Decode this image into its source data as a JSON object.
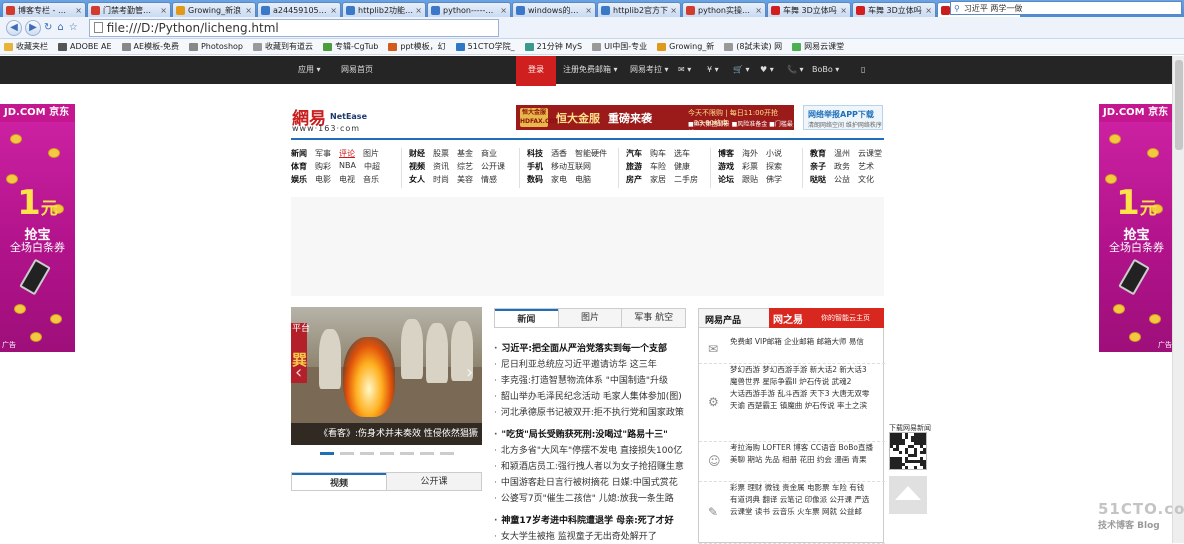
{
  "browser": {
    "tabs": [
      {
        "label": "博客专栏 - 博客",
        "color": "#d23c2e"
      },
      {
        "label": "门禁考勤管理系",
        "color": "#d23c2e"
      },
      {
        "label": "Growing_新浪",
        "color": "#e09a1a"
      },
      {
        "label": "a244591052的",
        "color": "#3c78c8"
      },
      {
        "label": "httplib2功能_百",
        "color": "#3c78c8"
      },
      {
        "label": "python-----httpl",
        "color": "#3c78c8"
      },
      {
        "label": "windows的pyth",
        "color": "#3c78c8"
      },
      {
        "label": "httplib2官方下",
        "color": "#3c78c8"
      },
      {
        "label": "python实操http",
        "color": "#d23c2e"
      },
      {
        "label": "车舞 3D立体吗",
        "color": "#d21e1e"
      },
      {
        "label": "车舞 3D立体吗",
        "color": "#d21e1e"
      },
      {
        "label": "网易",
        "color": "#c81e1e",
        "active": true
      }
    ],
    "new_tab": "+",
    "search_value": "习近平 两学一做",
    "url": "file:///D:/Python/licheng.html",
    "bookmarks": [
      {
        "label": "收藏夹栏",
        "color": "#e9b338"
      },
      {
        "label": "ADOBE AE",
        "color": "#555"
      },
      {
        "label": "AE模板-免费",
        "color": "#888"
      },
      {
        "label": "Photoshop",
        "color": "#888"
      },
      {
        "label": "收藏到有道云",
        "color": "#999"
      },
      {
        "label": "专辑-CgTub",
        "color": "#4a9c3c"
      },
      {
        "label": "ppt模板，幻",
        "color": "#d35a1a"
      },
      {
        "label": "51CTO学院_",
        "color": "#2d79c7"
      },
      {
        "label": "21分钟 MyS",
        "color": "#3a9b8c"
      },
      {
        "label": "UI中国-专业",
        "color": "#999"
      },
      {
        "label": "Growing_新",
        "color": "#e09a1a"
      },
      {
        "label": "(8試未读) 网",
        "color": "#999"
      },
      {
        "label": "网易云课堂",
        "color": "#4caf50"
      }
    ]
  },
  "topnav": {
    "items": [
      "应用 ▾",
      "网易首页",
      "注册免费邮箱 ▾",
      "网易考拉 ▾",
      "✉ ▾",
      "¥ ▾",
      "🛒 ▾",
      "♥ ▾",
      "📞 ▾",
      "BoBo ▾",
      "▯"
    ],
    "login": "登录"
  },
  "side_ad": {
    "brand": "JD.COM 京东",
    "amount": "1",
    "unit": "元",
    "line1": "抢宝",
    "line2": "全场白条券",
    "ad_tag": "广告"
  },
  "header": {
    "logo_cn": "網易",
    "logo_en": "NetEase",
    "logo_url": "www·163·com",
    "banner": {
      "badge": "恒大金服 HDFAX.COM",
      "brand": "恒大金服",
      "slogan": "重磅来袭",
      "line1": "今天不限购 | 每日11:00开抢~23:00结束",
      "line2": "■恒大集团背景 ■风险准备金 ■门槛最低1000元"
    },
    "app_ad": {
      "title": "网络举报APP下载",
      "sub": "清朗网络空间 维护网络秩序"
    }
  },
  "channels": [
    {
      "rows": [
        [
          {
            "t": "新闻",
            "b": true
          },
          {
            "t": "军事"
          },
          {
            "t": "评论",
            "r": true
          },
          {
            "t": "图片"
          }
        ],
        [
          {
            "t": "体育",
            "b": true
          },
          {
            "t": "购彩"
          },
          {
            "t": "NBA"
          },
          {
            "t": "中超"
          }
        ],
        [
          {
            "t": "娱乐",
            "b": true
          },
          {
            "t": "电影"
          },
          {
            "t": "电视"
          },
          {
            "t": "音乐"
          }
        ]
      ]
    },
    {
      "rows": [
        [
          {
            "t": "财经",
            "b": true
          },
          {
            "t": "股票"
          },
          {
            "t": "基金"
          },
          {
            "t": "商业"
          }
        ],
        [
          {
            "t": "视频",
            "b": true
          },
          {
            "t": "资讯"
          },
          {
            "t": "综艺"
          },
          {
            "t": "公开课"
          }
        ],
        [
          {
            "t": "女人",
            "b": true
          },
          {
            "t": "时尚"
          },
          {
            "t": "美容"
          },
          {
            "t": "情感"
          }
        ]
      ]
    },
    {
      "rows": [
        [
          {
            "t": "科技",
            "b": true
          },
          {
            "t": "酒香"
          },
          {
            "t": "智能硬件"
          }
        ],
        [
          {
            "t": "手机",
            "b": true
          },
          {
            "t": "移动互联网"
          }
        ],
        [
          {
            "t": "数码",
            "b": true
          },
          {
            "t": "家电"
          },
          {
            "t": "电脑"
          }
        ]
      ]
    },
    {
      "rows": [
        [
          {
            "t": "汽车",
            "b": true
          },
          {
            "t": "购车"
          },
          {
            "t": "选车"
          }
        ],
        [
          {
            "t": "旅游",
            "b": true
          },
          {
            "t": "车险"
          },
          {
            "t": "健康"
          }
        ],
        [
          {
            "t": "房产",
            "b": true
          },
          {
            "t": "家居"
          },
          {
            "t": "二手房"
          }
        ]
      ]
    },
    {
      "rows": [
        [
          {
            "t": "博客",
            "b": true
          },
          {
            "t": "海外"
          },
          {
            "t": "小说"
          }
        ],
        [
          {
            "t": "游戏",
            "b": true
          },
          {
            "t": "彩票"
          },
          {
            "t": "探索"
          }
        ],
        [
          {
            "t": "论坛",
            "b": true
          },
          {
            "t": "跟贴"
          },
          {
            "t": "佛学"
          }
        ]
      ]
    },
    {
      "rows": [
        [
          {
            "t": "教育",
            "b": true
          },
          {
            "t": "温州"
          },
          {
            "t": "云课堂"
          }
        ],
        [
          {
            "t": "亲子",
            "b": true
          },
          {
            "t": "政务"
          },
          {
            "t": "艺术"
          }
        ],
        [
          {
            "t": "哒哒",
            "b": true
          },
          {
            "t": "公益"
          },
          {
            "t": "文化"
          }
        ]
      ]
    }
  ],
  "slider": {
    "caption": "《看客》:伤身术并未奏效 性侵依然猖獗",
    "side_text": "平台",
    "side_text2": "巽"
  },
  "video_tabs": [
    "视频",
    "公开课"
  ],
  "news_tabs": [
    "新闻",
    "图片",
    "军事 航空"
  ],
  "news": [
    {
      "t": "习近平:把全面从严治党落实到每一个支部",
      "head": true
    },
    {
      "t": "尼日利亚总统应习近平邀请访华 这三年"
    },
    {
      "t": "李克强:打造智慧物流体系 \"中国制造\"升级"
    },
    {
      "t": "韶山举办毛泽民纪念活动 毛家人集体参加(图)"
    },
    {
      "t": "河北承德原书记被双开:拒不执行党和国家政策"
    },
    {
      "t": "\"吃货\"局长受贿获死刑:没喝过\"路易十三\"",
      "head": true
    },
    {
      "t": "北方多省\"大风车\"停摆不发电 直接损失100亿"
    },
    {
      "t": "和颍酒店员工:强行拽人者以为女子抢招赚生意"
    },
    {
      "t": "中国游客赴日言行被树摘花 日媒:中国式赏花"
    },
    {
      "t": "公婆写7页\"催生二孩信\" 儿媳:放我一条生路"
    },
    {
      "t": "神童17岁考进中科院遭退学 母亲:死了才好",
      "head": true
    },
    {
      "t": "女大学生被拖 监视童子无出奇处解开了"
    }
  ],
  "products": {
    "title": "网易产品",
    "brand": "网之易",
    "slogan": "你的智能云主页",
    "sections": [
      {
        "icon": "✉",
        "lines": [
          "免费邮  VIP邮箱  企业邮箱  邮箱大师  易信"
        ]
      },
      {
        "icon": "⚙",
        "lines": [
          "梦幻西游  梦幻西游手游  新大话2  新大话3",
          "魔兽世界  星际争霸II  炉石传说  武魂2",
          "大话西游手游  乱斗西游  天下3  大唐无双零",
          "天谕  西楚霸王 镇魔曲  炉石传说  率土之滨"
        ]
      },
      {
        "icon": "☺",
        "lines": [
          "考拉海购  LOFTER  博客  CC语音  BoBo直播",
          "美聊  期站  先品  相册  花田  约会  漫画  青果"
        ]
      },
      {
        "icon": "✎",
        "lines": [
          "彩票  理财  微钱  贵金属  电影票  车险  有钱",
          "有道词典  翻译  云笔记  印像派  公开课  严选",
          "云课堂  读书  云音乐  火车票  网就  公益邮"
        ]
      }
    ]
  },
  "right_misc": {
    "download_label": "下载网易新闻"
  },
  "watermark": {
    "site": "51CTO.com",
    "sub": "技术博客  Blog"
  },
  "colors": {
    "accent": "#1f6fb8",
    "brand_red": "#c81e1e",
    "topnav_bg": "#252525",
    "side_ad_bg": "#c0188f"
  }
}
